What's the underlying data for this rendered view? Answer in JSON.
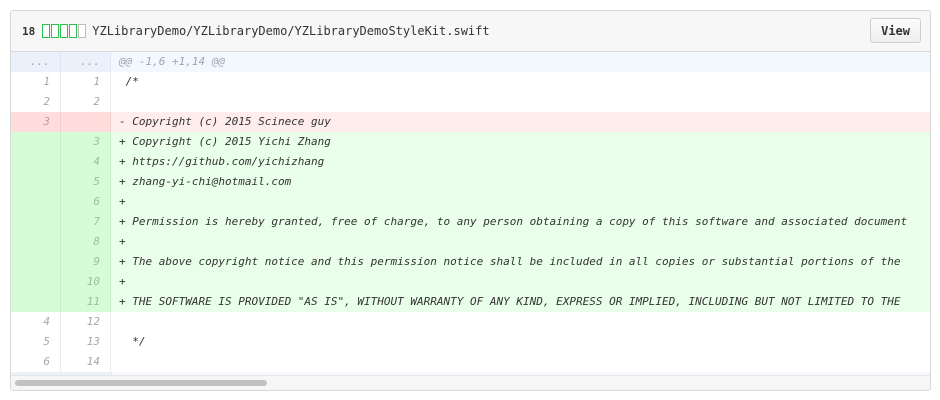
{
  "header": {
    "change_count": "18",
    "path": "YZLibraryDemo/YZLibraryDemo/YZLibraryDemoStyleKit.swift",
    "view_label": "View"
  },
  "hunk": {
    "old_placeholder": "...",
    "new_placeholder": "...",
    "text": "@@ -1,6 +1,14 @@"
  },
  "lines": [
    {
      "type": "context",
      "old": "1",
      "new": "1",
      "text": " /*"
    },
    {
      "type": "context",
      "old": "2",
      "new": "2",
      "text": ""
    },
    {
      "type": "del",
      "old": "3",
      "new": "",
      "text": "- Copyright (c) 2015 Scinece guy"
    },
    {
      "type": "add",
      "old": "",
      "new": "3",
      "text": "+ Copyright (c) 2015 Yichi Zhang"
    },
    {
      "type": "add",
      "old": "",
      "new": "4",
      "text": "+ https://github.com/yichizhang"
    },
    {
      "type": "add",
      "old": "",
      "new": "5",
      "text": "+ zhang-yi-chi@hotmail.com"
    },
    {
      "type": "add",
      "old": "",
      "new": "6",
      "text": "+"
    },
    {
      "type": "add",
      "old": "",
      "new": "7",
      "text": "+ Permission is hereby granted, free of charge, to any person obtaining a copy of this software and associated document"
    },
    {
      "type": "add",
      "old": "",
      "new": "8",
      "text": "+"
    },
    {
      "type": "add",
      "old": "",
      "new": "9",
      "text": "+ The above copyright notice and this permission notice shall be included in all copies or substantial portions of the"
    },
    {
      "type": "add",
      "old": "",
      "new": "10",
      "text": "+"
    },
    {
      "type": "add",
      "old": "",
      "new": "11",
      "text": "+ THE SOFTWARE IS PROVIDED \"AS IS\", WITHOUT WARRANTY OF ANY KIND, EXPRESS OR IMPLIED, INCLUDING BUT NOT LIMITED TO THE"
    },
    {
      "type": "context",
      "old": "4",
      "new": "12",
      "text": ""
    },
    {
      "type": "context",
      "old": "5",
      "new": "13",
      "text": "  */"
    },
    {
      "type": "context",
      "old": "6",
      "new": "14",
      "text": ""
    }
  ],
  "expander": {
    "icon": "unfold-icon"
  },
  "colors": {
    "add_bg": "#eaffea",
    "del_bg": "#ffecec",
    "diffstat_add": "#2cbe4e"
  }
}
